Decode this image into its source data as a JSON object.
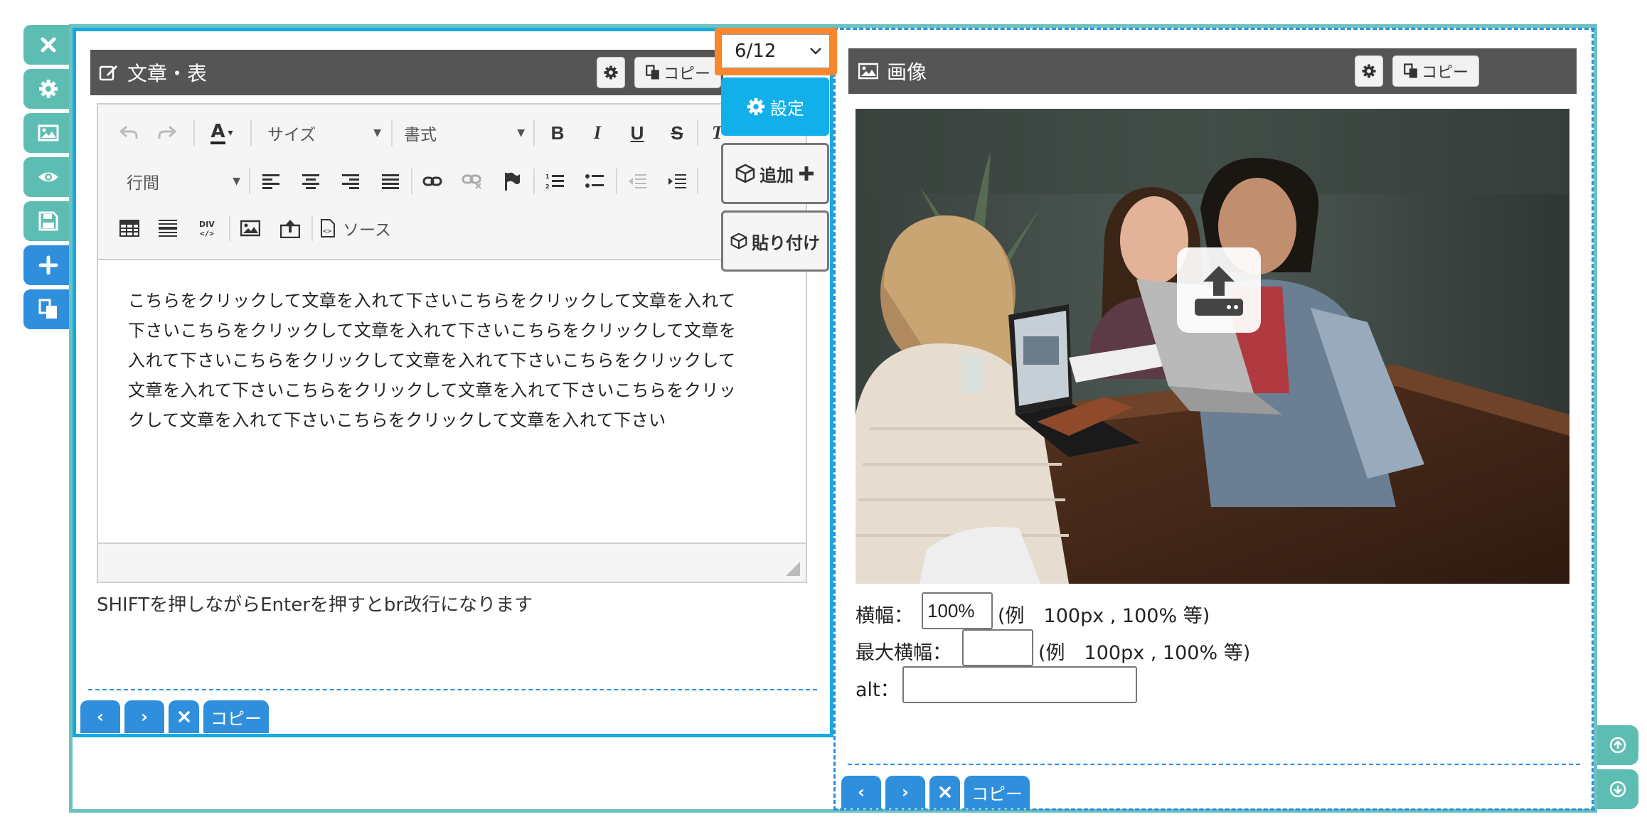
{
  "left_toolbar": {
    "icons": [
      "close-icon",
      "gear-icon",
      "image-icon",
      "eye-icon",
      "save-icon",
      "plus-icon",
      "copy-icon"
    ]
  },
  "column_selector": {
    "value": "6/12"
  },
  "floating_menu": {
    "settings_label": "設定",
    "add_label": "追加",
    "paste_label": "貼り付け"
  },
  "text_panel": {
    "title": "文章・表",
    "copy_label": "コピー",
    "toolbar": {
      "size_label": "サイズ",
      "format_label": "書式",
      "line_height_label": "行間",
      "source_label": "ソース"
    },
    "body_lines": [
      "こちらをクリックして文章を入れて下さいこちらをクリックして文章を入れて",
      "下さいこちらをクリックして文章を入れて下さいこちらをクリックして文章を",
      "入れて下さいこちらをクリックして文章を入れて下さいこちらをクリックして",
      "文章を入れて下さいこちらをクリックして文章を入れて下さいこちらをクリッ",
      "クして文章を入れて下さいこちらをクリックして文章を入れて下さい"
    ],
    "hint": "SHIFTを押しながらEnterを押すとbr改行になります",
    "nav_copy_label": "コピー"
  },
  "image_panel": {
    "title": "画像",
    "copy_label": "コピー",
    "width_label": "横幅：",
    "width_value": "100%",
    "width_example": "(例　100px , 100% 等)",
    "max_width_label": "最大横幅：",
    "max_width_value": "",
    "max_width_example": "(例　100px , 100% 等)",
    "alt_label": "alt：",
    "alt_value": "",
    "nav_copy_label": "コピー"
  },
  "colors": {
    "teal": "#5ebdb3",
    "blue": "#2f8fdd",
    "cyan": "#17a9e1",
    "orange": "#f7882f",
    "header_gray": "#555555"
  }
}
